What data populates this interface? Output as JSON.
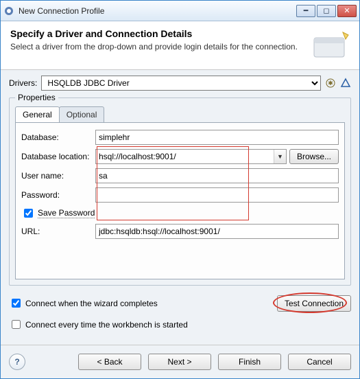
{
  "window": {
    "title": "New Connection Profile"
  },
  "header": {
    "h1": "Specify a Driver and Connection Details",
    "p": "Select a driver from the drop-down and provide login details for the connection."
  },
  "drivers": {
    "label": "Drivers:",
    "selected": "HSQLDB JDBC Driver"
  },
  "group": {
    "title": "Properties",
    "tabs": {
      "general": "General",
      "optional": "Optional"
    },
    "labels": {
      "database": "Database:",
      "dblocation": "Database location:",
      "username": "User name:",
      "password": "Password:",
      "save_password": "Save Password",
      "url": "URL:"
    },
    "values": {
      "database": "simplehr",
      "dblocation": "hsql://localhost:9001/",
      "username": "sa",
      "password": "",
      "url": "jdbc:hsqldb:hsql://localhost:9001/"
    },
    "buttons": {
      "browse": "Browse..."
    },
    "save_password_checked": true
  },
  "lower": {
    "test_connection": "Test Connection",
    "connect_complete": "Connect when the wizard completes",
    "connect_complete_checked": true,
    "connect_start": "Connect every time the workbench is started",
    "connect_start_checked": false
  },
  "footer": {
    "back": "< Back",
    "next": "Next >",
    "finish": "Finish",
    "cancel": "Cancel"
  }
}
